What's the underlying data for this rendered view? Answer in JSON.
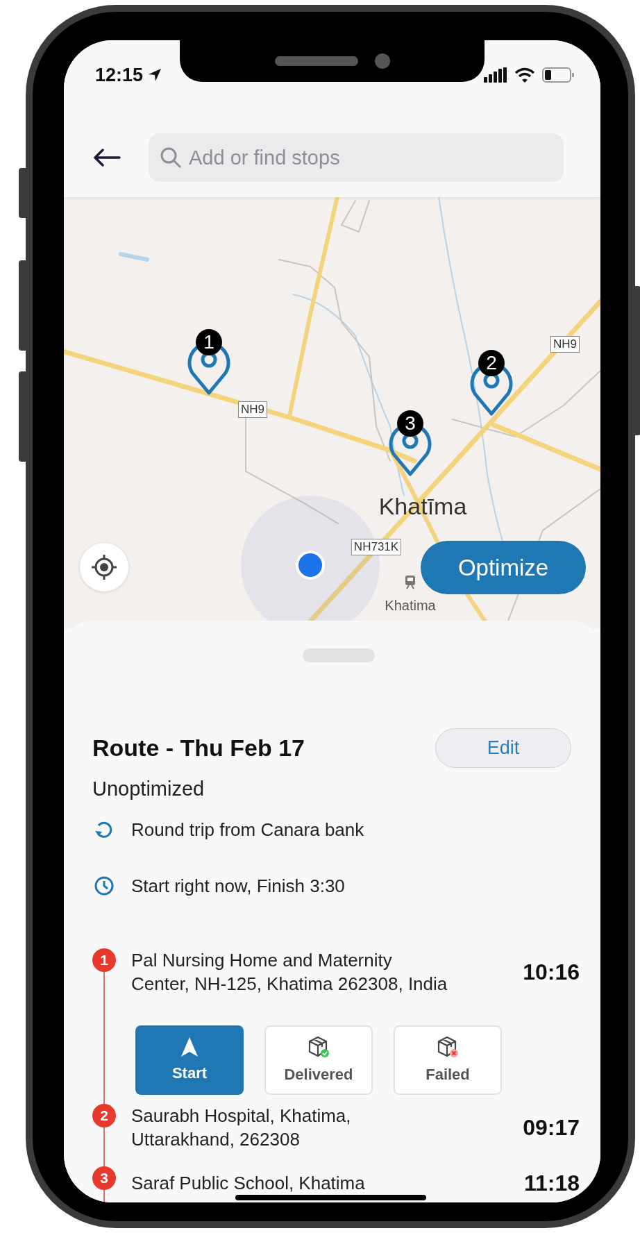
{
  "status_bar": {
    "time": "12:15"
  },
  "search": {
    "placeholder": "Add or find stops"
  },
  "map": {
    "labels": [
      {
        "kind": "road",
        "text": "NH9"
      },
      {
        "kind": "road",
        "text": "NH9"
      },
      {
        "kind": "city",
        "text": "Khatīma"
      },
      {
        "kind": "road",
        "text": "NH731K"
      },
      {
        "kind": "station",
        "text": "Khatima"
      }
    ],
    "pins": [
      {
        "number": "1"
      },
      {
        "number": "2"
      },
      {
        "number": "3"
      }
    ],
    "optimize_button": "Optimize"
  },
  "route": {
    "title": "Route - Thu Feb 17",
    "edit_button": "Edit",
    "status": "Unoptimized",
    "details": [
      {
        "kind": "round_trip",
        "text": "Round trip from Canara bank"
      },
      {
        "kind": "schedule",
        "text": "Start right now, Finish 3:30"
      }
    ]
  },
  "stops": [
    {
      "number": "1",
      "address": "Pal Nursing Home and Maternity\nCenter, NH-125, Khatima 262308, India",
      "time": "10:16",
      "actions": [
        {
          "kind": "start",
          "label": "Start"
        },
        {
          "kind": "delivered",
          "label": "Delivered"
        },
        {
          "kind": "failed",
          "label": "Failed"
        }
      ]
    },
    {
      "number": "2",
      "address": "Saurabh Hospital, Khatima,\nUttarakhand, 262308",
      "time": "09:17"
    },
    {
      "number": "3",
      "address": "Saraf Public School, Khatima",
      "time": "11:18"
    }
  ]
}
